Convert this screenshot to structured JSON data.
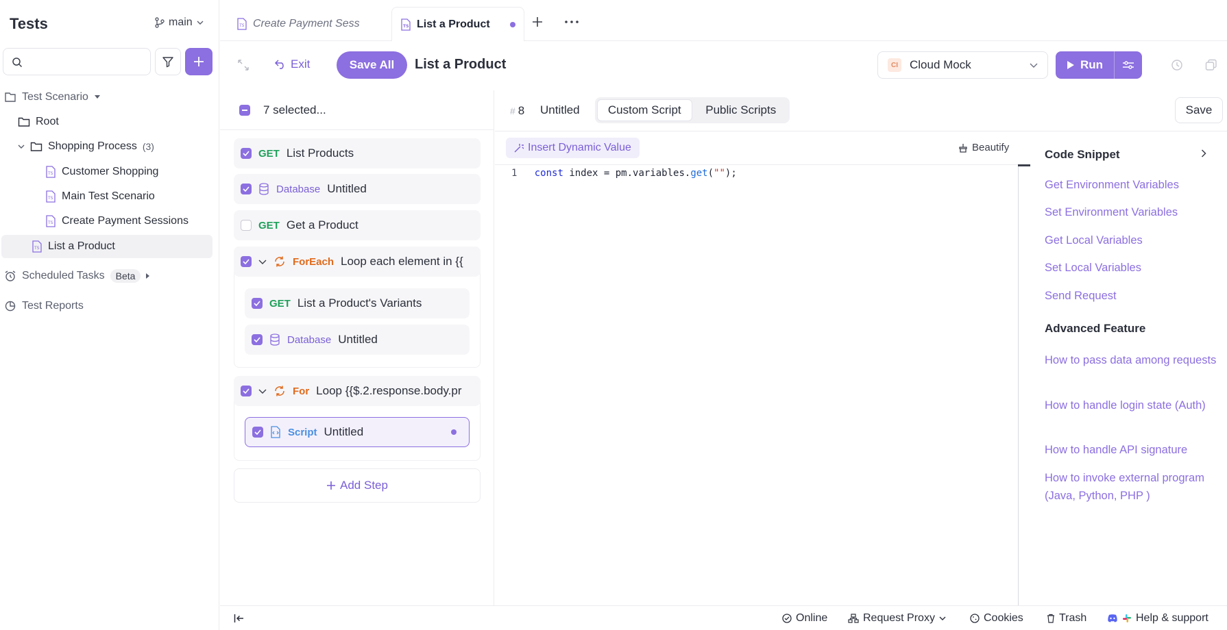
{
  "sidebar": {
    "title": "Tests",
    "branch": "main",
    "tree": {
      "scenario_root": "Test Scenario",
      "root_folder": "Root",
      "shopping_folder": "Shopping Process",
      "shopping_count": "(3)",
      "items": [
        "Customer Shopping",
        "Main Test Scenario",
        "Create Payment Sessions"
      ],
      "selected_item": "List a Product",
      "scheduled": "Scheduled Tasks",
      "beta_badge": "Beta",
      "reports": "Test Reports"
    }
  },
  "tabs": {
    "inactive": "Create Payment Sess",
    "active": "List a Product"
  },
  "toolbar": {
    "exit": "Exit",
    "save_all": "Save All",
    "title": "List a Product",
    "environment": "Cloud Mock",
    "environment_badge": "CI",
    "run": "Run"
  },
  "steps": {
    "selected_label": "7 selected...",
    "list": [
      {
        "method": "GET",
        "name": "List Products"
      },
      {
        "method": "Database",
        "name": "Untitled"
      },
      {
        "method": "GET",
        "name": "Get a Product"
      },
      {
        "method": "ForEach",
        "name": "Loop each element in {{"
      },
      {
        "method": "GET",
        "name": "List a Product's Variants"
      },
      {
        "method": "Database",
        "name": "Untitled"
      },
      {
        "method": "For",
        "name": "Loop {{$.2.response.body.pr"
      },
      {
        "method": "Script",
        "name": "Untitled"
      }
    ],
    "add_step": "Add Step"
  },
  "editor": {
    "step_number": "8",
    "step_name": "Untitled",
    "tabs": [
      "Custom Script",
      "Public Scripts"
    ],
    "save": "Save",
    "insert_dynamic": "Insert Dynamic Value",
    "beautify": "Beautify",
    "code": {
      "line_no": "1",
      "kw": "const",
      "mid": " index = pm.variables.",
      "fn": "get",
      "open": "(",
      "str": "\"\"",
      "close": ");"
    }
  },
  "snippets": {
    "header": "Code Snippet",
    "links": [
      "Get Environment Variables",
      "Set Environment Variables",
      "Get Local Variables",
      "Set Local Variables",
      "Send Request"
    ],
    "advanced_header": "Advanced Feature",
    "advanced_links": [
      "How to pass data among requests",
      "How to handle login state (Auth)",
      "How to handle API signature",
      "How to invoke external program (Java, Python, PHP )"
    ]
  },
  "status_bar": {
    "online": "Online",
    "proxy": "Request Proxy",
    "cookies": "Cookies",
    "trash": "Trash",
    "help": "Help & support"
  },
  "colors": {
    "accent": "#8c6fe0",
    "get": "#1f9f5a",
    "loop": "#e06a1c",
    "script": "#4a8fe0"
  }
}
